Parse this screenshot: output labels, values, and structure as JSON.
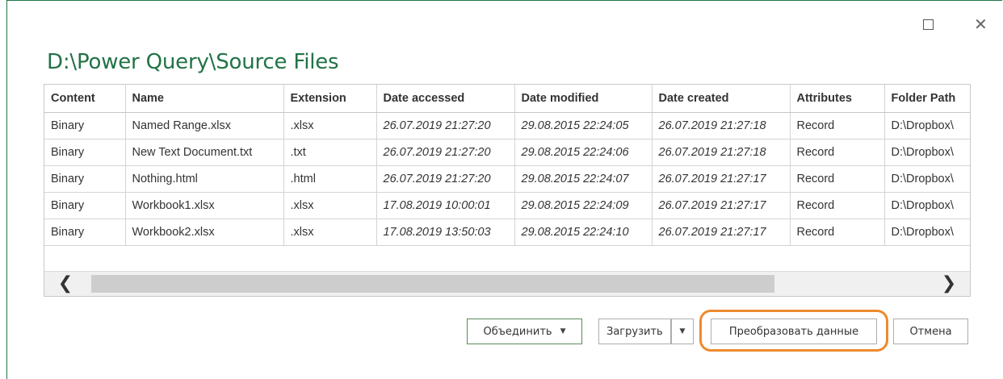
{
  "window": {
    "title": "D:\\Power Query\\Source Files"
  },
  "table": {
    "columns": [
      "Content",
      "Name",
      "Extension",
      "Date accessed",
      "Date modified",
      "Date created",
      "Attributes",
      "Folder Path"
    ],
    "rows": [
      [
        "Binary",
        "Named Range.xlsx",
        ".xlsx",
        "26.07.2019 21:27:20",
        "29.08.2015 22:24:05",
        "26.07.2019 21:27:18",
        "Record",
        "D:\\Dropbox\\"
      ],
      [
        "Binary",
        "New Text Document.txt",
        ".txt",
        "26.07.2019 21:27:20",
        "29.08.2015 22:24:06",
        "26.07.2019 21:27:18",
        "Record",
        "D:\\Dropbox\\"
      ],
      [
        "Binary",
        "Nothing.html",
        ".html",
        "26.07.2019 21:27:20",
        "29.08.2015 22:24:07",
        "26.07.2019 21:27:17",
        "Record",
        "D:\\Dropbox\\"
      ],
      [
        "Binary",
        "Workbook1.xlsx",
        ".xlsx",
        "17.08.2019 10:00:01",
        "29.08.2015 22:24:09",
        "26.07.2019 21:27:17",
        "Record",
        "D:\\Dropbox\\"
      ],
      [
        "Binary",
        "Workbook2.xlsx",
        ".xlsx",
        "17.08.2019 13:50:03",
        "29.08.2015 22:24:10",
        "26.07.2019 21:27:17",
        "Record",
        "D:\\Dropbox\\"
      ]
    ]
  },
  "scrollbar": {
    "left_icon": "chevron-left-icon",
    "right_icon": "chevron-right-icon"
  },
  "buttons": {
    "combine": "Объединить",
    "load": "Загрузить",
    "transform": "Преобразовать данные",
    "cancel": "Отмена"
  },
  "colors": {
    "title": "#217346",
    "highlight": "#ed8a2f"
  }
}
